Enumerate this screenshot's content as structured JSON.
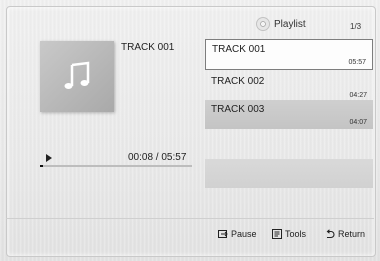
{
  "header": {
    "title": "Playlist",
    "count": "1/3"
  },
  "now_playing": {
    "track": "TRACK 001",
    "time": "00:08 / 05:57",
    "progress": 0.0224
  },
  "playlist": [
    {
      "title": "TRACK 001",
      "duration": "05:57",
      "state": "focused"
    },
    {
      "title": "TRACK 002",
      "duration": "04:27",
      "state": "normal"
    },
    {
      "title": "TRACK 003",
      "duration": "04:07",
      "state": "highlighted"
    }
  ],
  "footer": {
    "pause": "Pause",
    "tools": "Tools",
    "return": "Return"
  }
}
